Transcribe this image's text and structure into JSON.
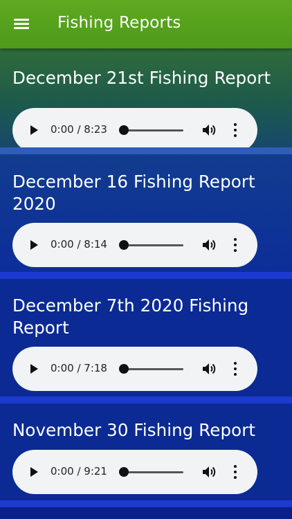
{
  "app": {
    "title": "Fishing Reports",
    "accent_color": "#5faa1f",
    "icons": {
      "menu": "hamburger-menu-icon",
      "play": "play-icon",
      "volume": "volume-icon",
      "more": "more-vert-icon"
    }
  },
  "reports": [
    {
      "title": "December 21st Fishing Report",
      "time": "0:00 / 8:23"
    },
    {
      "title": "December 16 Fishing Report 2020",
      "time": "0:00 / 8:14"
    },
    {
      "title": "December 7th 2020 Fishing Report",
      "time": "0:00 / 7:18"
    },
    {
      "title": "November 30 Fishing Report",
      "time": "0:00 / 9:21"
    }
  ]
}
